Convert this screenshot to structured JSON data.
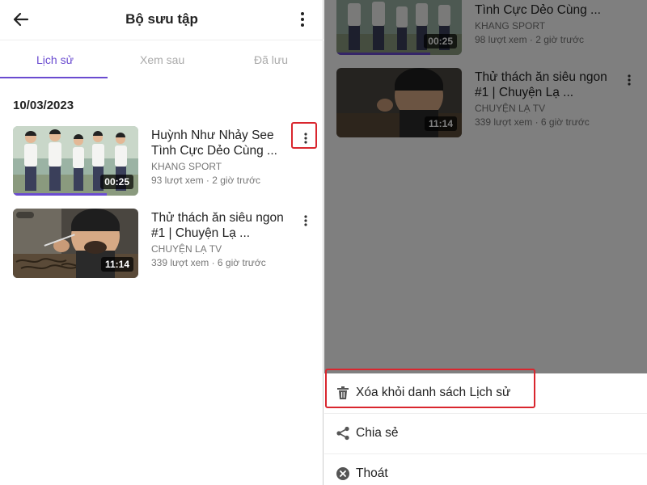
{
  "header": {
    "title": "Bộ sưu tập"
  },
  "tabs": [
    "Lịch sử",
    "Xem sau",
    "Đã lưu"
  ],
  "date": "10/03/2023",
  "videos": [
    {
      "title": "Huỳnh Như Nhảy See Tình Cực Dẻo Cùng ...",
      "channel": "KHANG SPORT",
      "stats": "93 lượt xem · 2 giờ trước",
      "duration": "00:25",
      "progress": 0.75
    },
    {
      "title": "Thử thách ăn siêu ngon #1 | Chuyện Lạ ...",
      "channel": "CHUYỆN LẠ TV",
      "stats": "339 lượt xem · 6 giờ trước",
      "duration": "11:14",
      "progress": 0
    }
  ],
  "right_videos": [
    {
      "title": "Tình Cực Dẻo Cùng ...",
      "channel": "KHANG SPORT",
      "stats": "98 lượt xem · 2 giờ trước",
      "duration": "00:25"
    },
    {
      "title": "Thử thách ăn siêu ngon #1 | Chuyện Lạ ...",
      "channel": "CHUYỆN LẠ TV",
      "stats": "339 lượt xem · 6 giờ trước",
      "duration": "11:14"
    }
  ],
  "sheet": {
    "delete": "Xóa khỏi danh sách Lịch sử",
    "share": "Chia sẻ",
    "exit": "Thoát"
  },
  "colors": {
    "accent": "#6a4bd0",
    "highlight": "#d9262e"
  }
}
